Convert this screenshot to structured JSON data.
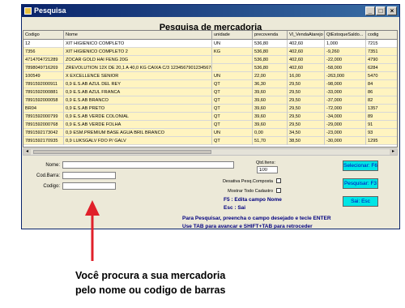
{
  "window": {
    "title": "Pesquisa",
    "header": "Pesquisa de mercadoria"
  },
  "grid": {
    "columns": [
      "Codigo",
      "Nome",
      "unidade",
      "precovenda",
      "Vl_VendaAtarejo",
      "QtEstoqueSaldo...",
      "codig"
    ],
    "rows": [
      [
        "12",
        "XIT HIGIENICO COMPLETO",
        "UN",
        "536,80",
        "402,60",
        "1,000",
        "7215"
      ],
      [
        "7356",
        "XIT HIGIENICO COMPLETO 2",
        "KG",
        "536,80",
        "402,60",
        "-9,260",
        "7351"
      ],
      [
        "4714704721289",
        "ZOCAR GOLD HAI FENG 20G",
        "",
        "536,80",
        "402,60",
        "-22,000",
        "4790"
      ],
      [
        "7898049716269",
        "ZREVOLUTION 12X DE 20,1 A 40,0 KG CAIXA C/3 1234567901234567890123...",
        "",
        "536,80",
        "402,60",
        "-58,000",
        "6284"
      ],
      [
        "100549",
        "X EXCELLENCE SENIOR",
        "UN",
        "22,00",
        "16,00",
        "-263,000",
        "5470"
      ],
      [
        "7891592000911",
        "0,9 E.S.AB AZUL DEL REY",
        "QT",
        "36,30",
        "29,50",
        "-98,000",
        "84"
      ],
      [
        "7891592000881",
        "0,9 E.S.AB AZUL FRANCA",
        "QT",
        "39,60",
        "29,50",
        "-33,000",
        "86"
      ],
      [
        "7891592000058",
        "0,9 E.S.AB BRANCO",
        "QT",
        "39,60",
        "29,50",
        "-37,000",
        "82"
      ],
      [
        "BR04",
        "0,9 E.S.AB PRETO",
        "QT",
        "39,60",
        "29,50",
        "-72,000",
        "1357"
      ],
      [
        "7891592000799",
        "0,9 E.S.AB VERDE COLONIAL",
        "QT",
        "39,60",
        "29,50",
        "-34,000",
        "89"
      ],
      [
        "7891592000768",
        "0,9 E.S.AB VERDE FOLHA",
        "QT",
        "39,60",
        "29,50",
        "-29,000",
        "91"
      ],
      [
        "7891592173042",
        "0,9 ESM.PREMIUM BASE AGUA BRIL BRANCO",
        "UN",
        "0,00",
        "34,50",
        "-23,000",
        "93"
      ],
      [
        "7891592170935",
        "0,9 LUKSGALV FDO P/ GALV",
        "QT",
        "51,70",
        "38,50",
        "-30,000",
        "1295"
      ]
    ]
  },
  "form": {
    "nome_label": "Nome:",
    "codbarra_label": "Cod.Barra:",
    "codigo_label": "Codigo:",
    "nome_value": "",
    "codbarra_value": "",
    "codigo_value": "",
    "qtd_label": "Qtd.Itens:",
    "qtd_value": "100",
    "desativa_label": "Desativa Pesq.Composta",
    "mostrar_label": "Mostrar Todo Cadastro"
  },
  "buttons": {
    "selecionar": "Selecionar: F6",
    "pesquisar": "Pesquisar: F3",
    "sair": "Sai: Esc"
  },
  "info": {
    "line1": "F5 : Edita campo Nome",
    "line2": "Esc : Sai",
    "line3": "Para Pesquisar, preencha o campo desejado e tecle ENTER",
    "line4": "Use TAB para avancar e SHIFT+TAB para retroceder"
  },
  "caption": {
    "line1": "Você procura a sua mercadoria",
    "line2": "pelo nome ou codigo de barras"
  },
  "colors": {
    "row_highlight": "#fff4c0",
    "button": "#00e5e5",
    "arrow": "#e0202a"
  }
}
